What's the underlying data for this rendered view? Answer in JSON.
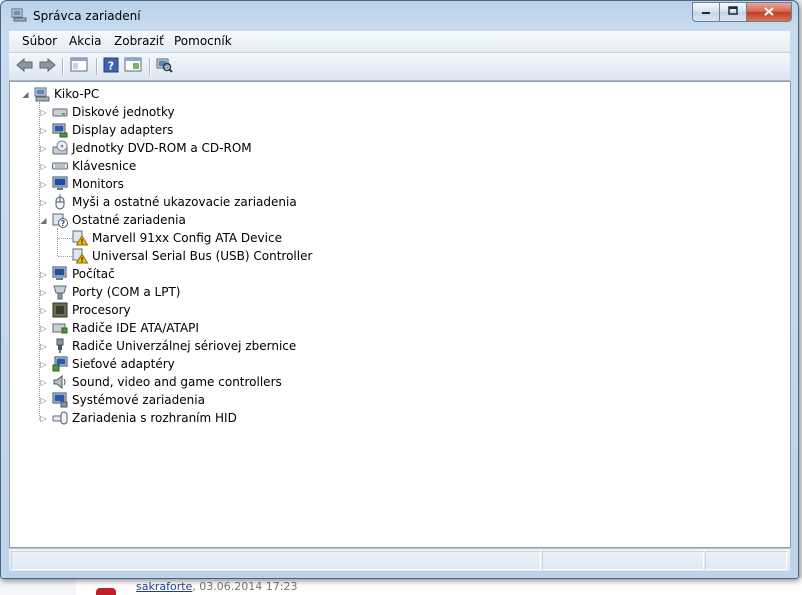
{
  "window": {
    "title": "Správca zariadení"
  },
  "menu": [
    "Súbor",
    "Akcia",
    "Zobraziť",
    "Pomocník"
  ],
  "toolbar": {
    "icons": [
      "back-arrow-icon",
      "forward-arrow-icon",
      "show-hide-console-tree-icon",
      "help-icon",
      "properties-icon",
      "scan-hardware-icon"
    ]
  },
  "tree": {
    "root": "Kiko-PC",
    "categories": [
      "Diskové jednotky",
      "Display adapters",
      "Jednotky DVD-ROM a CD-ROM",
      "Klávesnice",
      "Monitors",
      "Myši a ostatné ukazovacie zariadenia",
      "Ostatné zariadenia",
      "Počítač",
      "Porty (COM a LPT)",
      "Procesory",
      "Radiče IDE ATA/ATAPI",
      "Radiče Univerzálnej sériovej zbernice",
      "Sieťové adaptéry",
      "Sound, video and game controllers",
      "Systémové zariadenia",
      "Zariadenia s rozhraním HID"
    ],
    "expanded_category_index": 6,
    "children": [
      "Marvell 91xx Config ATA Device",
      "Universal Serial Bus (USB) Controller"
    ]
  },
  "background": {
    "author": "sakraforte",
    "date": ", 03.06.2014 17:23"
  },
  "colors": {
    "title_bar": "#c9dcef",
    "close_button": "#c13e22",
    "warning": "#f2c200"
  }
}
